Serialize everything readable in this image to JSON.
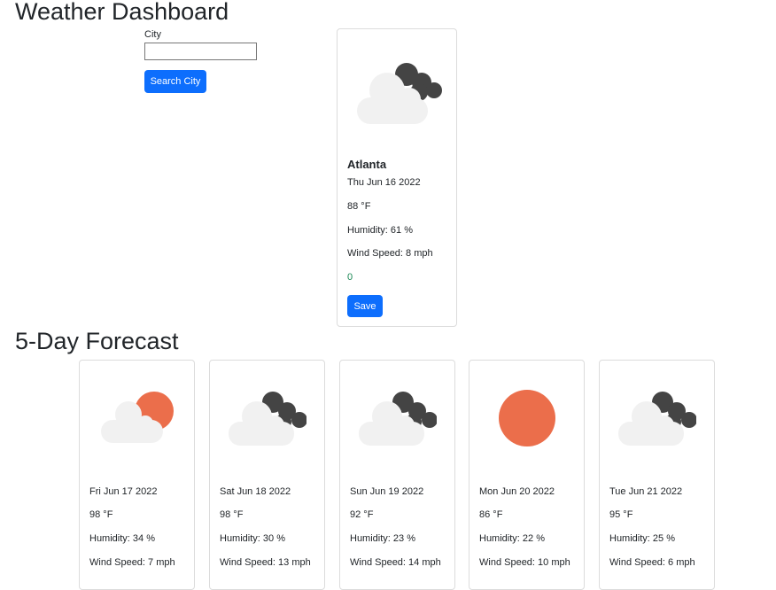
{
  "header": {
    "title": "Weather Dashboard"
  },
  "search": {
    "label": "City",
    "value": "",
    "placeholder": "",
    "button": "Search City"
  },
  "current": {
    "city": "Atlanta",
    "date": "Thu Jun 16 2022",
    "temp": "88 °F",
    "humidity": "Humidity: 61 %",
    "wind": "Wind Speed: 8 mph",
    "uv": "0",
    "save_label": "Save",
    "icon": "dark-cloudy-icon"
  },
  "forecast": {
    "title": "5-Day Forecast",
    "days": [
      {
        "date": "Fri Jun 17 2022",
        "temp": "98 °F",
        "humidity": "Humidity: 34 %",
        "wind": "Wind Speed: 7 mph",
        "icon": "partly-sunny-icon"
      },
      {
        "date": "Sat Jun 18 2022",
        "temp": "98 °F",
        "humidity": "Humidity: 30 %",
        "wind": "Wind Speed: 13 mph",
        "icon": "dark-cloudy-icon"
      },
      {
        "date": "Sun Jun 19 2022",
        "temp": "92 °F",
        "humidity": "Humidity: 23 %",
        "wind": "Wind Speed: 14 mph",
        "icon": "dark-cloudy-icon"
      },
      {
        "date": "Mon Jun 20 2022",
        "temp": "86 °F",
        "humidity": "Humidity: 22 %",
        "wind": "Wind Speed: 10 mph",
        "icon": "sun-icon"
      },
      {
        "date": "Tue Jun 21 2022",
        "temp": "95 °F",
        "humidity": "Humidity: 25 %",
        "wind": "Wind Speed: 6 mph",
        "icon": "dark-cloudy-icon"
      }
    ]
  },
  "colors": {
    "accent": "#0d6efd",
    "sun": "#eb6e4b",
    "cloud_light": "#f1f1f1",
    "cloud_dark": "#444444",
    "uv_text": "#198754"
  }
}
